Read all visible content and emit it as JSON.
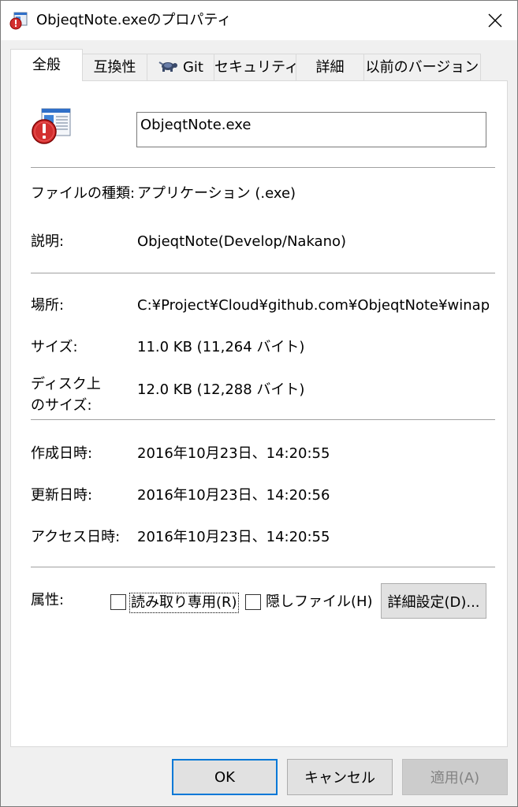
{
  "window": {
    "title": "ObjeqtNote.exeのプロパティ",
    "title_icon": "exe-app-icon",
    "close_icon": "close-icon"
  },
  "tabs": [
    {
      "label": "全般",
      "active": true
    },
    {
      "label": "互換性",
      "active": false
    },
    {
      "label": "Git",
      "icon": "git-tortoise-icon",
      "active": false
    },
    {
      "label": "セキュリティ",
      "active": false
    },
    {
      "label": "詳細",
      "active": false
    },
    {
      "label": "以前のバージョン",
      "active": false
    }
  ],
  "general": {
    "file_name": "ObjeqtNote.exe",
    "file_type_label": "ファイルの種類:",
    "file_type_value": "アプリケーション (.exe)",
    "description_label": "説明:",
    "description_value": "ObjeqtNote(Develop/Nakano)",
    "location_label": "場所:",
    "location_value": "C:¥Project¥Cloud¥github.com¥ObjeqtNote¥winap",
    "size_label": "サイズ:",
    "size_value": "11.0 KB (11,264 バイト)",
    "size_on_disk_label_line1": "ディスク上",
    "size_on_disk_label_line2": "のサイズ:",
    "size_on_disk_value": "12.0 KB (12,288 バイト)",
    "created_label": "作成日時:",
    "created_value": "2016年10月23日、14:20:55",
    "modified_label": "更新日時:",
    "modified_value": "2016年10月23日、14:20:56",
    "accessed_label": "アクセス日時:",
    "accessed_value": "2016年10月23日、14:20:55",
    "attributes_label": "属性:",
    "readonly_label": "読み取り専用(R)",
    "readonly_checked": false,
    "hidden_label": "隠しファイル(H)",
    "hidden_checked": false,
    "advanced_button": "詳細設定(D)..."
  },
  "footer": {
    "ok": "OK",
    "cancel": "キャンセル",
    "apply": "適用(A)",
    "apply_enabled": false
  },
  "colors": {
    "dialog_bg": "#f0f0f0",
    "panel_bg": "#ffffff",
    "accent": "#0078d7",
    "warning_red": "#d32f2f"
  }
}
